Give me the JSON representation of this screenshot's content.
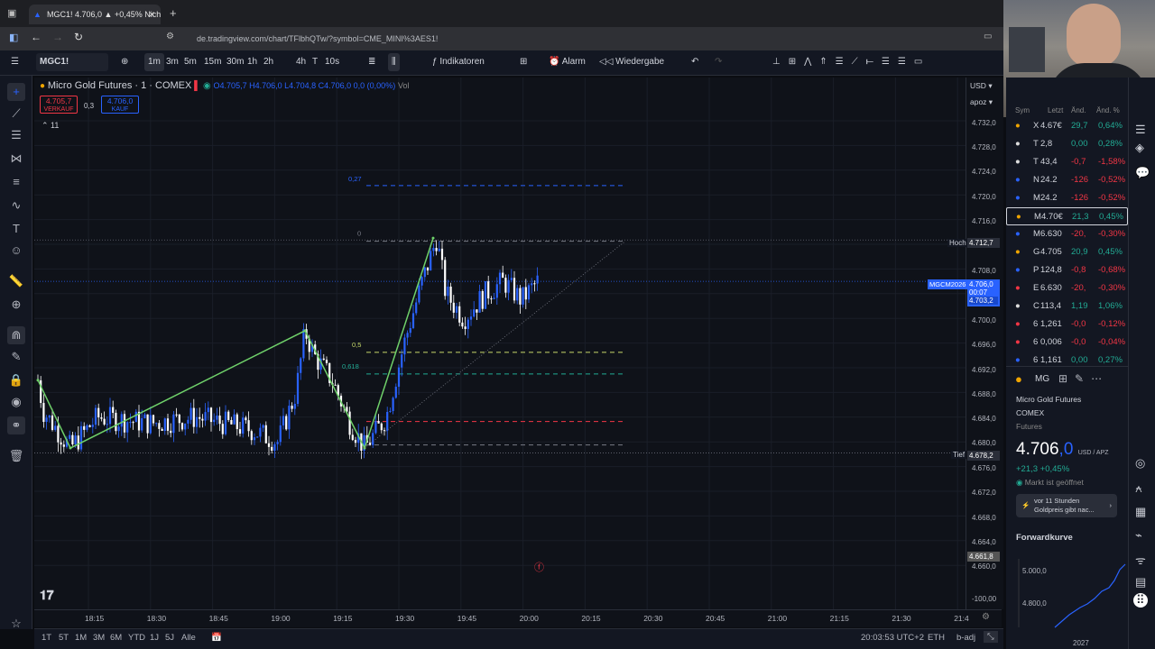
{
  "browser": {
    "tab_title": "MGC1! 4.706,0 ▲ +0,45% Nicht",
    "url": "de.tradingview.com/chart/TFlbhQTw/?symbol=CME_MINI%3AES1!"
  },
  "toolbar": {
    "symbol": "MGC1!",
    "intervals": [
      "1m",
      "3m",
      "5m",
      "15m",
      "30m",
      "1h",
      "2h",
      "4h",
      "T",
      "10s"
    ],
    "active_interval": "1m",
    "indicators_label": "Indikatoren",
    "alarm_label": "Alarm",
    "replay_label": "Wiedergabe"
  },
  "legend": {
    "title": "Micro Gold Futures · 1 · COMEX",
    "ohlc": "O4.705,7  H4.706,0  L4.704,8  C4.706,0  0,0 (0,00%)",
    "vol": "Vol",
    "sell_price": "4.705,7",
    "sell_label": "VERKAUF",
    "spread": "0,3",
    "buy_price": "4.706,0",
    "buy_label": "KAUF",
    "collapse_count": "11"
  },
  "fib_labels": {
    "f027": "0,27",
    "f0": "0",
    "f05": "0,5",
    "f0618": "0,618"
  },
  "price_axis": {
    "currency": "USD",
    "unit": "apoz",
    "ticks": [
      "4.732,0",
      "4.728,0",
      "4.724,0",
      "4.720,0",
      "4.716,0",
      "4.708,0",
      "4.700,0",
      "4.696,0",
      "4.692,0",
      "4.688,0",
      "4.684,0",
      "4.680,0",
      "4.676,0",
      "4.672,0",
      "4.668,0",
      "4.664,0",
      "4.660,0",
      "-100,00"
    ],
    "high_label": "Hoch",
    "high_value": "4.712,7",
    "low_label": "Tief",
    "low_value": "4.678,2",
    "contract_label": "MGCM2026",
    "last_price": "4.706,0",
    "countdown": "00:07",
    "second_price": "4.703,2",
    "lower_value": "4.661,8"
  },
  "time_axis": [
    "18:15",
    "18:30",
    "18:45",
    "19:00",
    "19:15",
    "19:30",
    "19:45",
    "20:00",
    "20:15",
    "20:30",
    "20:45",
    "21:00",
    "21:15",
    "21:30",
    "21:4"
  ],
  "bottom_bar": {
    "ranges": [
      "1T",
      "5T",
      "1M",
      "3M",
      "6M",
      "YTD",
      "1J",
      "5J",
      "Alle"
    ],
    "clock": "20:03:53 UTC+2",
    "session": "ETH",
    "adj": "b-adj"
  },
  "watchlist": {
    "headers": [
      "Sym",
      "Letzt",
      "Änd.",
      "Änd. %"
    ],
    "rows": [
      {
        "sym": "X",
        "last": "4.67€",
        "chg": "29,7",
        "pct": "0,64%",
        "dir": "up"
      },
      {
        "sym": "T",
        "last": "2,8",
        "chg": "0,00",
        "pct": "0,28%",
        "dir": "up"
      },
      {
        "sym": "T",
        "last": "43,4",
        "chg": "-0,7",
        "pct": "-1,58%",
        "dir": "down"
      },
      {
        "sym": "N",
        "last": "24.2",
        "chg": "-126",
        "pct": "-0,52%",
        "dir": "down"
      },
      {
        "sym": "M",
        "last": "24.2",
        "chg": "-126",
        "pct": "-0,52%",
        "dir": "down"
      },
      {
        "sym": "M",
        "last": "4.70€",
        "chg": "21,3",
        "pct": "0,45%",
        "dir": "up"
      },
      {
        "sym": "M",
        "last": "6.630",
        "chg": "-20,",
        "pct": "-0,30%",
        "dir": "down"
      },
      {
        "sym": "G",
        "last": "4.705",
        "chg": "20,9",
        "pct": "0,45%",
        "dir": "up"
      },
      {
        "sym": "P",
        "last": "124,8",
        "chg": "-0,8",
        "pct": "-0,68%",
        "dir": "down"
      },
      {
        "sym": "E",
        "last": "6.630",
        "chg": "-20,",
        "pct": "-0,30%",
        "dir": "down"
      },
      {
        "sym": "C",
        "last": "113,4",
        "chg": "1,19",
        "pct": "1,06%",
        "dir": "up"
      },
      {
        "sym": "6",
        "last": "1,261",
        "chg": "-0,0",
        "pct": "-0,12%",
        "dir": "down"
      },
      {
        "sym": "6",
        "last": "0,006",
        "chg": "-0,0",
        "pct": "-0,04%",
        "dir": "down"
      },
      {
        "sym": "6",
        "last": "1,161",
        "chg": "0,00",
        "pct": "0,27%",
        "dir": "up"
      }
    ]
  },
  "details": {
    "symbol_short": "MG",
    "name": "Micro Gold Futures",
    "exchange": "COMEX",
    "type": "Futures",
    "price_main": "4.706",
    "price_dec": ",0",
    "price_unit": "USD / APZ",
    "change": "+21,3  +0,45%",
    "market_status": "Markt ist geöffnet",
    "news_time": "vor 11 Stunden",
    "news_text": "Goldpreis gibt nac...",
    "forward_curve_title": "Forwardkurve",
    "fc_y1": "5.000,0",
    "fc_y2": "4.800,0",
    "fc_x": "2027"
  },
  "colors": {
    "bull": "#2962ff",
    "bear": "#ffffff",
    "zigzag": "#6fd16a",
    "accent": "#2962ff",
    "down": "#f23645",
    "up": "#22ab94"
  }
}
